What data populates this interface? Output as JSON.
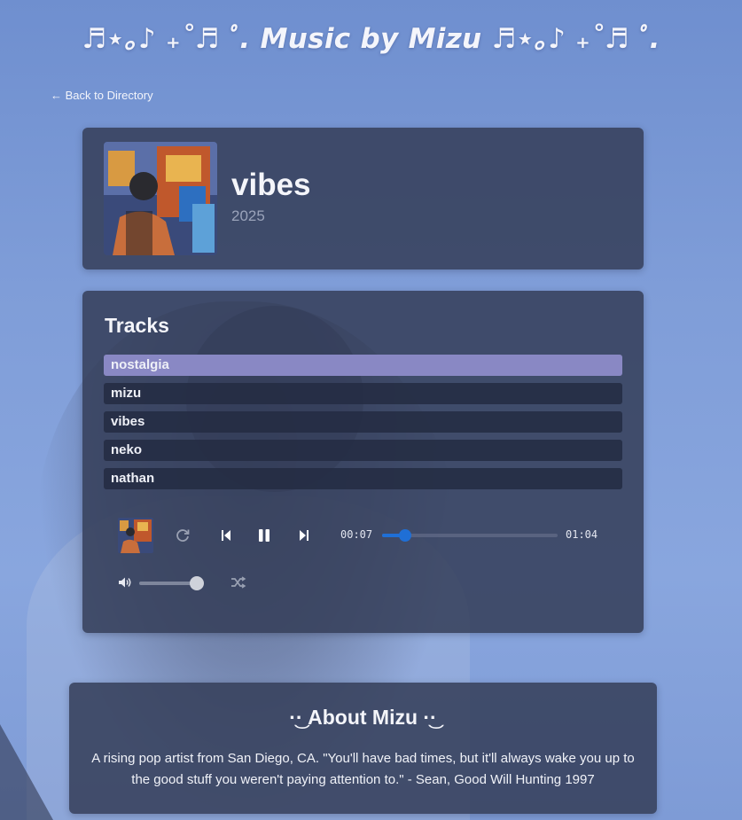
{
  "site": {
    "title": "♬⋆｡♪ ₊˚♬ ﾟ. Music by Mizu ♬⋆｡♪ ₊˚♬ ﾟ.",
    "back_link": "← Back to Directory"
  },
  "album": {
    "name": "vibes",
    "year": "2025"
  },
  "tracks": {
    "heading": "Tracks",
    "items": [
      {
        "label": "nostalgia",
        "active": true
      },
      {
        "label": "mizu",
        "active": false
      },
      {
        "label": "vibes",
        "active": false
      },
      {
        "label": "neko",
        "active": false
      },
      {
        "label": "nathan",
        "active": false
      }
    ]
  },
  "player": {
    "current_time": "00:07",
    "duration": "01:04",
    "progress": 0.13,
    "volume": 0.9,
    "icons": [
      "repeat-icon",
      "previous-icon",
      "pause-icon",
      "next-icon",
      "volume-icon",
      "shuffle-icon"
    ],
    "accent_color": "#1f6fd6"
  },
  "about": {
    "heading": "·͜· About Mizu ·͜·",
    "text": "A rising pop artist from San Diego, CA. \"You'll have bad times, but it'll always wake you up to the good stuff you weren't paying attention to.\" - Sean, Good Will Hunting 1997"
  },
  "colors": {
    "card_bg": "#343e58",
    "active_track": "#8988c4",
    "page_bg": "#7f9dd8"
  }
}
